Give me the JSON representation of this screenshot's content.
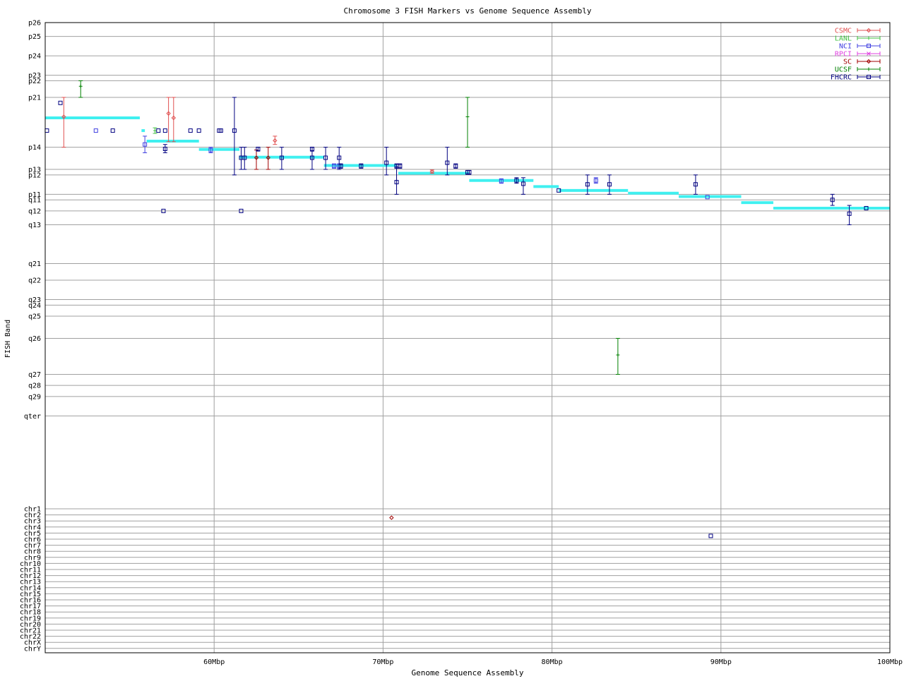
{
  "chart_data": {
    "type": "scatter",
    "title": "Chromosome 3 FISH Markers vs Genome Sequence Assembly",
    "xlabel": "Genome Sequence Assembly",
    "ylabel": "FISH Band",
    "x_unit": "Mbp",
    "xlim": [
      50,
      100
    ],
    "grid": true,
    "legend_position": "top-right",
    "x_ticks": [
      {
        "value": 60,
        "label": "60Mbp"
      },
      {
        "value": 70,
        "label": "70Mbp"
      },
      {
        "value": 80,
        "label": "80Mbp"
      },
      {
        "value": 90,
        "label": "90Mbp"
      },
      {
        "value": 100,
        "label": "100Mbp"
      }
    ],
    "bands": [
      {
        "label": "p26",
        "pos": 0.0
      },
      {
        "label": "p25",
        "pos": 2.5
      },
      {
        "label": "p24",
        "pos": 6.0
      },
      {
        "label": "p23",
        "pos": 9.5
      },
      {
        "label": "p22",
        "pos": 10.5
      },
      {
        "label": "p21",
        "pos": 13.5
      },
      {
        "label": "p14",
        "pos": 22.5
      },
      {
        "label": "p13",
        "pos": 26.5
      },
      {
        "label": "p12",
        "pos": 27.5
      },
      {
        "label": "p11",
        "pos": 31.0
      },
      {
        "label": "q11",
        "pos": 32.0
      },
      {
        "label": "q12",
        "pos": 34.0
      },
      {
        "label": "q13",
        "pos": 36.5
      },
      {
        "label": "q21",
        "pos": 43.5
      },
      {
        "label": "q22",
        "pos": 46.5
      },
      {
        "label": "q23",
        "pos": 50.0
      },
      {
        "label": "q24",
        "pos": 51.0
      },
      {
        "label": "q25",
        "pos": 53.0
      },
      {
        "label": "q26",
        "pos": 57.0
      },
      {
        "label": "q27",
        "pos": 63.5
      },
      {
        "label": "q28",
        "pos": 65.5
      },
      {
        "label": "q29",
        "pos": 67.5
      },
      {
        "label": "qter",
        "pos": 71.0
      }
    ],
    "chromosomes": [
      "chr1",
      "chr2",
      "chr3",
      "chr4",
      "chr5",
      "chr6",
      "chr7",
      "chr8",
      "chr9",
      "chr10",
      "chr11",
      "chr12",
      "chr13",
      "chr14",
      "chr15",
      "chr16",
      "chr17",
      "chr18",
      "chr19",
      "chr20",
      "chr21",
      "chr22",
      "chrX",
      "chrY"
    ],
    "legend": [
      {
        "name": "CSMC",
        "color": "#e05050",
        "marker": "diamond"
      },
      {
        "name": "LANL",
        "color": "#40c040",
        "marker": "plus"
      },
      {
        "name": "NCI",
        "color": "#4040e0",
        "marker": "square"
      },
      {
        "name": "RPCI",
        "color": "#e040e0",
        "marker": "cross"
      },
      {
        "name": "SC",
        "color": "#a00000",
        "marker": "diamond"
      },
      {
        "name": "UCSF",
        "color": "#008000",
        "marker": "plus"
      },
      {
        "name": "FHCRC",
        "color": "#000080",
        "marker": "square"
      }
    ],
    "assembly_segments": [
      {
        "x1": 50.0,
        "x2": 55.6,
        "y": 17.2
      },
      {
        "x1": 55.7,
        "x2": 55.9,
        "y": 19.5
      },
      {
        "x1": 56.0,
        "x2": 59.1,
        "y": 21.4
      },
      {
        "x1": 59.1,
        "x2": 61.5,
        "y": 22.9
      },
      {
        "x1": 61.5,
        "x2": 66.5,
        "y": 24.3
      },
      {
        "x1": 66.5,
        "x2": 70.8,
        "y": 25.8
      },
      {
        "x1": 70.9,
        "x2": 75.1,
        "y": 27.2
      },
      {
        "x1": 75.1,
        "x2": 78.9,
        "y": 28.5
      },
      {
        "x1": 78.9,
        "x2": 80.4,
        "y": 29.6
      },
      {
        "x1": 80.4,
        "x2": 84.5,
        "y": 30.3
      },
      {
        "x1": 84.5,
        "x2": 87.5,
        "y": 30.8
      },
      {
        "x1": 87.5,
        "x2": 91.2,
        "y": 31.4
      },
      {
        "x1": 91.2,
        "x2": 93.1,
        "y": 32.5
      },
      {
        "x1": 93.1,
        "x2": 100.0,
        "y": 33.5
      }
    ],
    "series": [
      {
        "name": "CSMC",
        "points": [
          {
            "x": 51.1,
            "y": 17.0,
            "y_lo": 13.5,
            "y_hi": 22.5
          },
          {
            "x": 57.3,
            "y": 16.4,
            "y_lo": 13.5,
            "y_hi": 21.5
          },
          {
            "x": 57.6,
            "y": 17.2,
            "y_lo": 13.5,
            "y_hi": 21.5
          },
          {
            "x": 63.6,
            "y": 21.3,
            "y_lo": 20.5,
            "y_hi": 22.0
          },
          {
            "x": 72.9,
            "y": 26.9,
            "y_lo": 26.6,
            "y_hi": 27.2
          }
        ]
      },
      {
        "name": "LANL",
        "points": [
          {
            "x": 56.5,
            "y": 19.5,
            "y_lo": 19.0,
            "y_hi": 20.0
          }
        ]
      },
      {
        "name": "NCI",
        "points": [
          {
            "x": 53.0,
            "y": 19.5
          },
          {
            "x": 55.9,
            "y": 22.0,
            "y_lo": 20.5,
            "y_hi": 23.5
          },
          {
            "x": 59.8,
            "y": 23.0,
            "y_lo": 22.5,
            "y_hi": 23.5
          },
          {
            "x": 67.1,
            "y": 25.9,
            "y_lo": 25.5,
            "y_hi": 26.3
          },
          {
            "x": 67.4,
            "y": 25.9,
            "y_lo": 25.5,
            "y_hi": 26.3
          },
          {
            "x": 77.0,
            "y": 28.6,
            "y_lo": 28.2,
            "y_hi": 29.0
          },
          {
            "x": 82.6,
            "y": 28.5,
            "y_lo": 28.0,
            "y_hi": 29.0
          },
          {
            "x": 89.2,
            "y": 31.5
          }
        ]
      },
      {
        "name": "RPCI",
        "points": []
      },
      {
        "name": "SC",
        "points": [
          {
            "x": 63.2,
            "y": 24.4,
            "y_lo": 22.5,
            "y_hi": 26.5
          },
          {
            "x": 62.5,
            "y": 24.4,
            "y_lo": 23.0,
            "y_hi": 26.5
          }
        ]
      },
      {
        "name": "UCSF",
        "points": [
          {
            "x": 52.1,
            "y": 11.5,
            "y_lo": 10.5,
            "y_hi": 13.5
          },
          {
            "x": 75.0,
            "y": 17.0,
            "y_lo": 13.5,
            "y_hi": 22.5
          },
          {
            "x": 83.9,
            "y": 60.0,
            "y_lo": 57.0,
            "y_hi": 63.5
          }
        ]
      },
      {
        "name": "FHCRC",
        "points": [
          {
            "x": 50.1,
            "y": 19.5
          },
          {
            "x": 50.9,
            "y": 14.5
          },
          {
            "x": 54.0,
            "y": 19.5
          },
          {
            "x": 56.7,
            "y": 19.5
          },
          {
            "x": 57.1,
            "y": 19.5
          },
          {
            "x": 57.1,
            "y": 22.8,
            "y_lo": 22.0,
            "y_hi": 23.5
          },
          {
            "x": 57.0,
            "y": 34.0
          },
          {
            "x": 58.6,
            "y": 19.5
          },
          {
            "x": 59.1,
            "y": 19.5
          },
          {
            "x": 60.3,
            "y": 19.5
          },
          {
            "x": 60.4,
            "y": 19.5
          },
          {
            "x": 61.2,
            "y": 19.5,
            "y_lo": 13.5,
            "y_hi": 27.5
          },
          {
            "x": 61.6,
            "y": 24.4,
            "y_lo": 22.5,
            "y_hi": 26.5
          },
          {
            "x": 61.8,
            "y": 24.4,
            "y_lo": 22.5,
            "y_hi": 26.5
          },
          {
            "x": 61.6,
            "y": 34.0
          },
          {
            "x": 62.6,
            "y": 22.8,
            "y_lo": 22.5,
            "y_hi": 23.2
          },
          {
            "x": 64.0,
            "y": 24.4,
            "y_lo": 22.5,
            "y_hi": 26.5
          },
          {
            "x": 65.8,
            "y": 22.8,
            "y_lo": 22.5,
            "y_hi": 23.2
          },
          {
            "x": 65.8,
            "y": 24.4,
            "y_lo": 22.5,
            "y_hi": 26.5
          },
          {
            "x": 66.6,
            "y": 24.4,
            "y_lo": 22.5,
            "y_hi": 26.5
          },
          {
            "x": 67.4,
            "y": 24.4,
            "y_lo": 22.5,
            "y_hi": 26.5
          },
          {
            "x": 67.5,
            "y": 25.9,
            "y_lo": 25.5,
            "y_hi": 26.3
          },
          {
            "x": 68.7,
            "y": 25.9,
            "y_lo": 25.5,
            "y_hi": 26.3
          },
          {
            "x": 70.2,
            "y": 25.3,
            "y_lo": 22.5,
            "y_hi": 27.5
          },
          {
            "x": 70.8,
            "y": 25.9,
            "y_lo": 25.5,
            "y_hi": 26.3
          },
          {
            "x": 71.0,
            "y": 25.9,
            "y_lo": 25.5,
            "y_hi": 26.3
          },
          {
            "x": 70.8,
            "y": 28.8,
            "y_lo": 26.0,
            "y_hi": 31.0
          },
          {
            "x": 73.8,
            "y": 25.3,
            "y_lo": 22.5,
            "y_hi": 27.5
          },
          {
            "x": 74.3,
            "y": 25.9,
            "y_lo": 25.5,
            "y_hi": 26.3
          },
          {
            "x": 75.0,
            "y": 27.0,
            "y_lo": 26.7,
            "y_hi": 27.4
          },
          {
            "x": 75.1,
            "y": 27.0,
            "y_lo": 26.7,
            "y_hi": 27.4
          },
          {
            "x": 77.9,
            "y": 28.5,
            "y_lo": 28.0,
            "y_hi": 29.0
          },
          {
            "x": 78.3,
            "y": 29.1,
            "y_lo": 28.0,
            "y_hi": 31.0
          },
          {
            "x": 80.4,
            "y": 30.3
          },
          {
            "x": 82.1,
            "y": 29.2,
            "y_lo": 27.5,
            "y_hi": 31.0
          },
          {
            "x": 83.4,
            "y": 29.2,
            "y_lo": 27.5,
            "y_hi": 31.0
          },
          {
            "x": 88.5,
            "y": 29.2,
            "y_lo": 27.5,
            "y_hi": 31.0
          },
          {
            "x": 96.6,
            "y": 32.0,
            "y_lo": 31.0,
            "y_hi": 33.0
          },
          {
            "x": 97.6,
            "y": 34.5,
            "y_lo": 33.0,
            "y_hi": 36.5
          },
          {
            "x": 98.6,
            "y": 33.5
          }
        ]
      }
    ],
    "other_chromosome_points": [
      {
        "series": "SC",
        "x": 70.5,
        "chromosome": "chr2"
      },
      {
        "series": "FHCRC",
        "x": 89.4,
        "chromosome": "chr5"
      }
    ]
  }
}
